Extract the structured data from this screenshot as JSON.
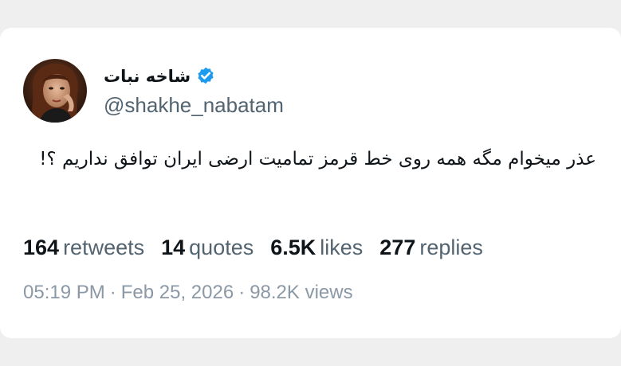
{
  "author": {
    "display_name": "شاخه نبات",
    "handle": "@shakhe_nabatam",
    "avatar_icon": "user-avatar-photo",
    "verified_icon": "verified-badge-icon",
    "verified_color": "#1d9bf0"
  },
  "tweet": {
    "text": "عذر میخوام مگه همه روی خط قرمز تمامیت ارضی ایران توافق نداریم ؟!"
  },
  "stats": [
    {
      "value": "164",
      "label": "retweets"
    },
    {
      "value": "14",
      "label": "quotes"
    },
    {
      "value": "6.5K",
      "label": "likes"
    },
    {
      "value": "277",
      "label": "replies"
    }
  ],
  "meta": {
    "time": "05:19 PM",
    "date": "Feb 25, 2026",
    "views": "98.2K views",
    "separator": "·"
  }
}
